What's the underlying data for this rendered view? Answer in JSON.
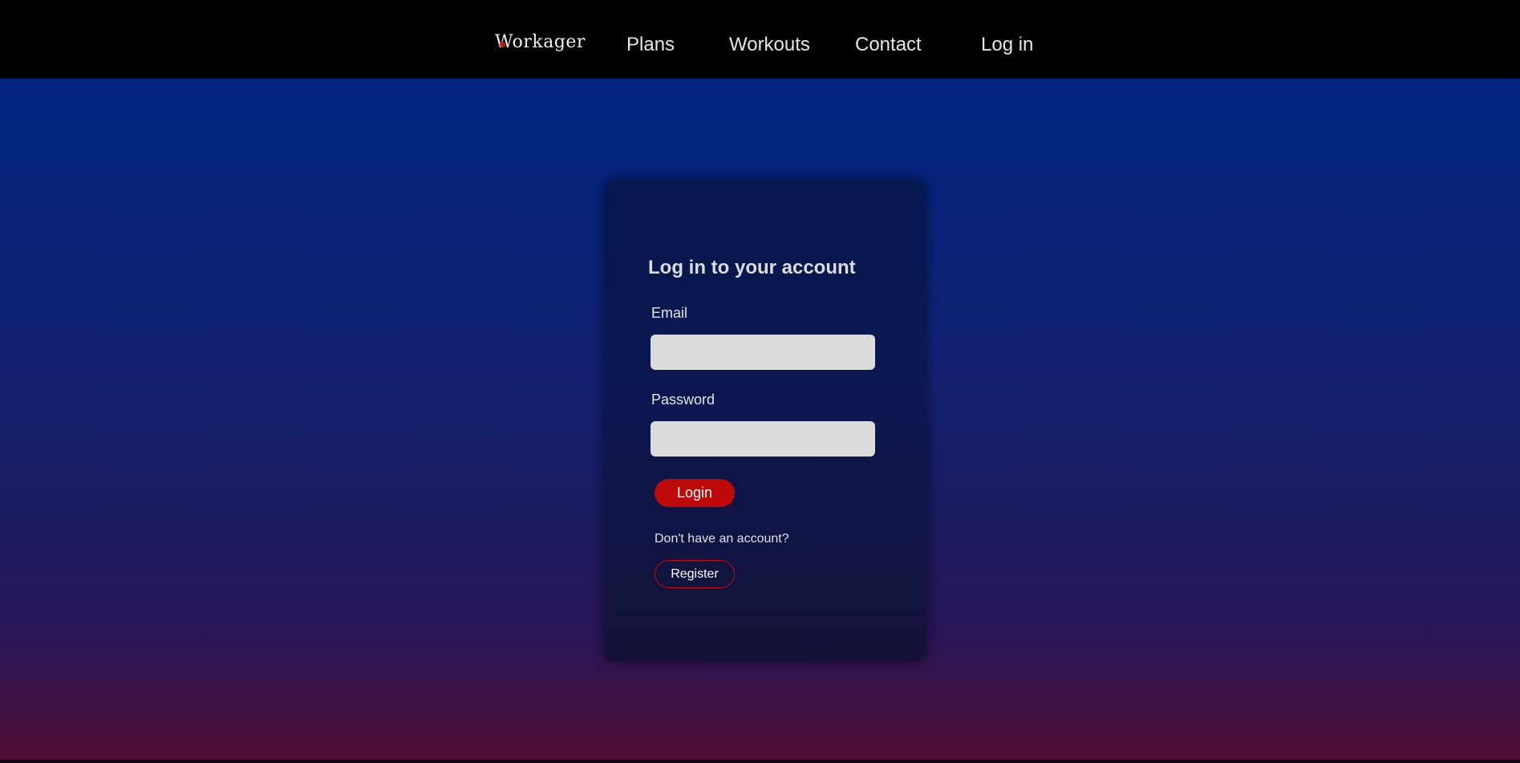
{
  "navbar": {
    "brand": "Workager",
    "links": [
      {
        "label": "Plans"
      },
      {
        "label": "Workouts"
      },
      {
        "label": "Contact"
      },
      {
        "label": "Log in"
      }
    ]
  },
  "login_card": {
    "title": "Log in to your account",
    "email_label": "Email",
    "email_value": "",
    "password_label": "Password",
    "password_value": "",
    "login_button": "Login",
    "register_prompt": "Don't have an account?",
    "register_button": "Register"
  },
  "colors": {
    "accent": "#c00a0a",
    "navbar_background": "#000000",
    "input_background": "#dcdbdc",
    "gradient_top": "#00237e",
    "gradient_bottom": "#520c35"
  }
}
